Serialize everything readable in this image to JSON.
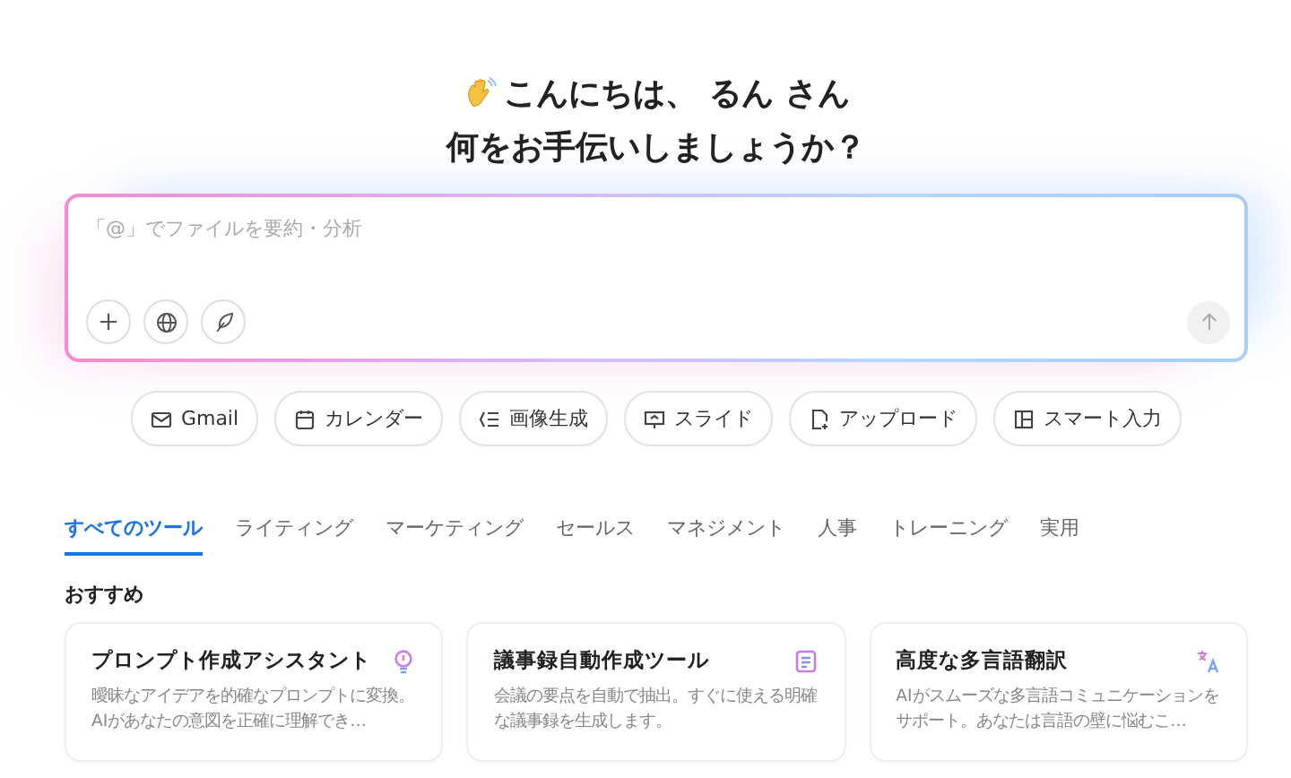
{
  "greeting": {
    "line1": "こんにちは、 るん さん",
    "line2": "何をお手伝いしましょうか？"
  },
  "input": {
    "placeholder": "「@」でファイルを要約・分析"
  },
  "shortcuts": [
    {
      "label": "Gmail",
      "kind": "mail"
    },
    {
      "label": "カレンダー",
      "kind": "calendar"
    },
    {
      "label": "画像生成",
      "kind": "list"
    },
    {
      "label": "スライド",
      "kind": "slide"
    },
    {
      "label": "アップロード",
      "kind": "upload"
    },
    {
      "label": "スマート入力",
      "kind": "layout"
    }
  ],
  "tabs": [
    {
      "label": "すべてのツール",
      "selected": true
    },
    {
      "label": "ライティング",
      "selected": false
    },
    {
      "label": "マーケティング",
      "selected": false
    },
    {
      "label": "セールス",
      "selected": false
    },
    {
      "label": "マネジメント",
      "selected": false
    },
    {
      "label": "人事",
      "selected": false
    },
    {
      "label": "トレーニング",
      "selected": false
    },
    {
      "label": "実用",
      "selected": false
    }
  ],
  "section_title": "おすすめ",
  "cards": [
    {
      "title": "プロンプト作成アシスタント",
      "description": "曖昧なアイデアを的確なプロンプトに変換。AIがあなたの意図を正確に理解でき…",
      "kind": "bulb"
    },
    {
      "title": "議事録自動作成ツール",
      "description": "会議の要点を自動で抽出。すぐに使える明確な議事録を生成します。",
      "kind": "notes"
    },
    {
      "title": "高度な多言語翻訳",
      "description": "AIがスムーズな多言語コミュニケーションをサポート。あなたは言語の壁に悩むこ…",
      "kind": "translate"
    }
  ]
}
